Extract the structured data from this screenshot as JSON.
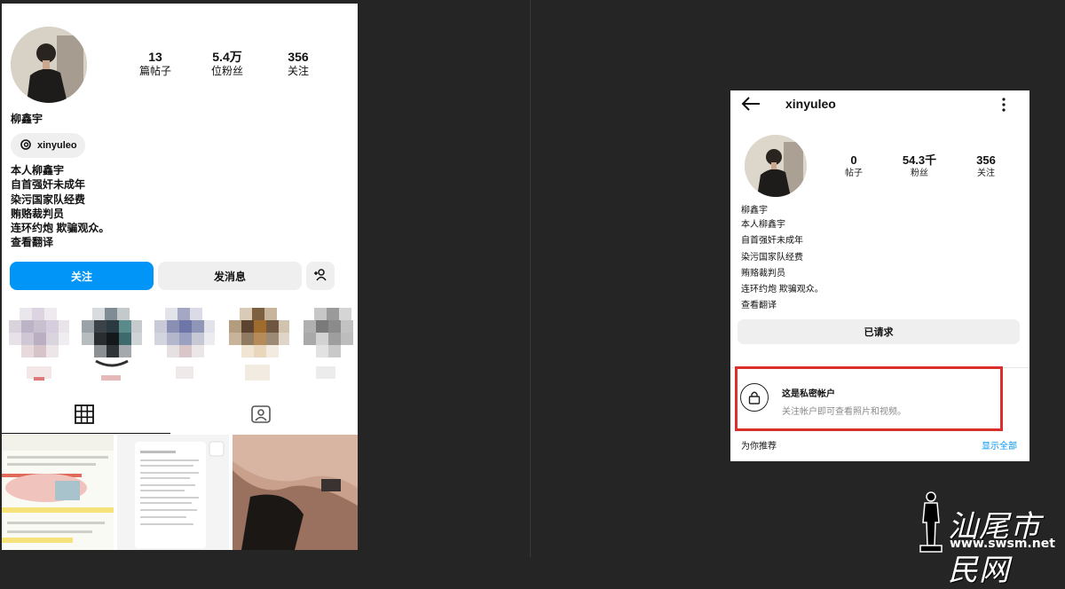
{
  "left_profile": {
    "stats": [
      {
        "value": "13",
        "label": "篇帖子"
      },
      {
        "value": "5.4万",
        "label": "位粉丝"
      },
      {
        "value": "356",
        "label": "关注"
      }
    ],
    "name": "柳鑫宇",
    "threads_handle": "xinyuleo",
    "bio": [
      "本人柳鑫宇",
      "自首强奸未成年",
      "染污国家队经费",
      "贿赂裁判员",
      "连环约炮 欺骗观众。",
      "查看翻译"
    ],
    "follow_label": "关注",
    "message_label": "发消息",
    "accent": "#0095f6"
  },
  "right_profile": {
    "username": "xinyuleo",
    "stats": [
      {
        "value": "0",
        "label": "帖子"
      },
      {
        "value": "54.3千",
        "label": "粉丝"
      },
      {
        "value": "356",
        "label": "关注"
      }
    ],
    "name": "柳鑫宇",
    "bio": [
      "本人柳鑫宇",
      "自首强奸未成年",
      "染污国家队经费",
      "贿赂裁判员",
      "连环约炮 欺骗观众。",
      "查看翻译"
    ],
    "requested_label": "已请求",
    "private_title": "这是私密帐户",
    "private_subtitle": "关注帐户即可查看照片和视频。",
    "recommend_label": "为你推荐",
    "show_all_label": "显示全部",
    "highlight_border": "#d9302c"
  },
  "watermark": {
    "title": "汕尾市民网",
    "url": "www.swsm.net"
  }
}
